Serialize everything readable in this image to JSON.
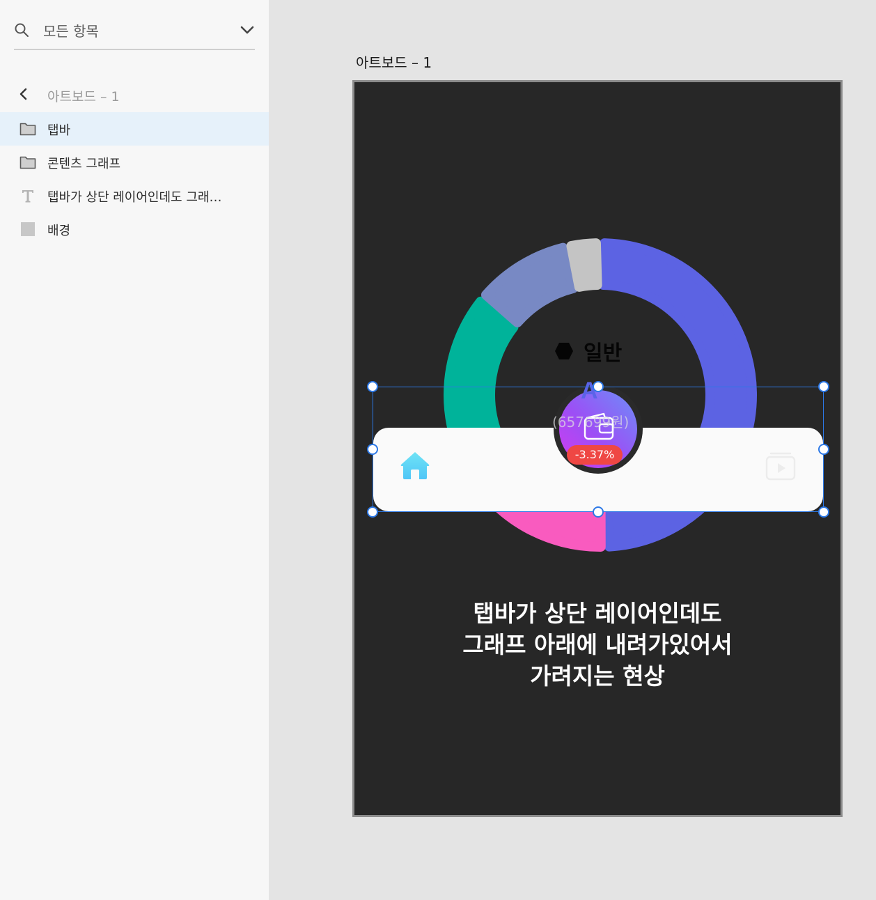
{
  "layers_panel": {
    "search": {
      "label": "모든 항목",
      "icon": "search-icon",
      "dropdown_icon": "chevron-down-icon"
    },
    "back": {
      "icon": "chevron-left-icon",
      "label": "아트보드 – 1"
    },
    "items": [
      {
        "label": "탭바",
        "icon": "folder-icon",
        "selected": true
      },
      {
        "label": "콘텐츠 그래프",
        "icon": "folder-icon",
        "selected": false
      },
      {
        "label": "탭바가 상단 레이어인데도 그래…",
        "icon": "text-icon",
        "selected": false
      },
      {
        "label": "배경",
        "icon": "rectangle-icon",
        "selected": false
      }
    ]
  },
  "canvas": {
    "artboard_title": "아트보드 – 1",
    "chart_label": "일반",
    "amount": "(657699원)",
    "percent": "-3.37%",
    "caption_lines": [
      "탭바가 상단 레이어인데도",
      "그래프 아래에 내려가있어서",
      "가려지는 현상"
    ],
    "tabbar_icons": [
      "home-icon",
      "wallet-icon",
      "video-icon"
    ]
  },
  "chart_data": {
    "type": "pie",
    "variant": "donut",
    "slices": [
      {
        "value": 49.5,
        "color": "#5c63e3"
      },
      {
        "value": 17.5,
        "color": "#f95bbf"
      },
      {
        "value": 19.0,
        "color": "#00b39a"
      },
      {
        "value": 10.5,
        "color": "#7889c4"
      },
      {
        "value": 3.5,
        "color": "#c4c4c4"
      }
    ]
  },
  "colors": {
    "accent_selection": "#2c78e6",
    "artboard_background": "#272727",
    "panel_selected": "#e6f1fa",
    "badge": "#ef4744",
    "home_icon": "#5ed7f7"
  }
}
